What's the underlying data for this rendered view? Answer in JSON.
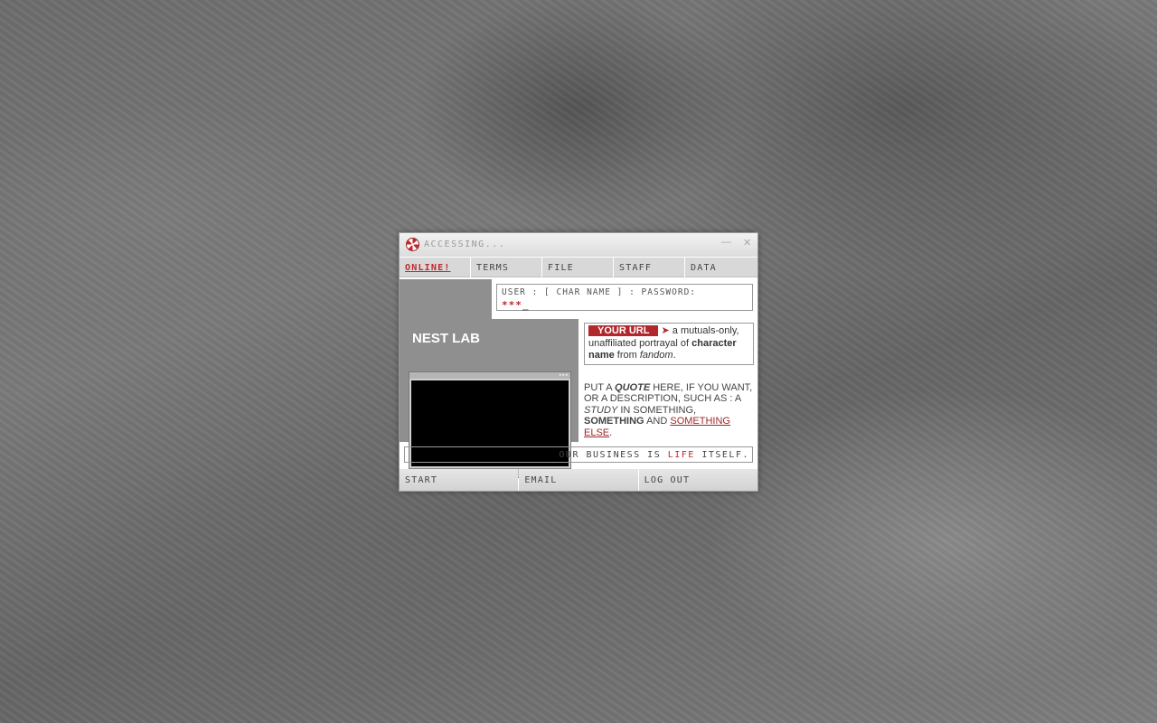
{
  "window": {
    "title": "ACCESSING...",
    "minimize_glyph": "—",
    "close_glyph": "✕",
    "logo_icon": "umbrella-logo-icon"
  },
  "tabs": [
    {
      "label": "ONLINE!",
      "active": true
    },
    {
      "label": "TERMS",
      "active": false
    },
    {
      "label": "FILE",
      "active": false
    },
    {
      "label": "STAFF",
      "active": false
    },
    {
      "label": "DATA",
      "active": false
    }
  ],
  "site_title": "NEST LAB",
  "login": {
    "label": "USER : [ CHAR NAME ] : PASSWORD:",
    "password_mask": "***",
    "cursor": "_"
  },
  "info": {
    "url_badge": "YOUR URL",
    "arrow": "➤",
    "text_1": " a mutuals-only, unaffiliated portrayal of ",
    "bold_1": "character name",
    "text_2": " from ",
    "italic_1": "fandom",
    "text_3": "."
  },
  "quote": {
    "p1": "PUT A ",
    "b1": "QUOTE",
    "p2": " HERE, IF YOU WANT, OR A DESCRIPTION, SUCH AS : A ",
    "i1": "STUDY",
    "p3": " IN SOMETHING, ",
    "b2": "SOMETHING",
    "p4": " AND ",
    "u1": "SOMETHING ELSE",
    "p5": "."
  },
  "tagline": {
    "pre": "OUR BUSINESS IS ",
    "highlight": "LIFE",
    "post": " ITSELF."
  },
  "footer": [
    "START",
    "EMAIL",
    "LOG OUT"
  ],
  "colors": {
    "accent_red": "#b3262c",
    "panel_grey": "#8f8f8f",
    "tab_grey": "#d8d8d8"
  }
}
